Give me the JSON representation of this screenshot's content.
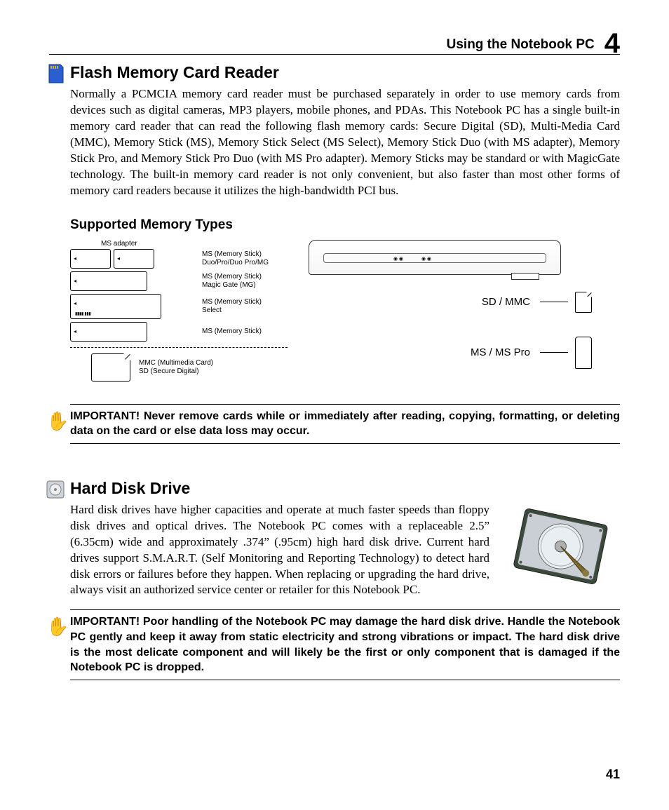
{
  "header": {
    "section_title": "Using the Notebook PC",
    "chapter_number": "4"
  },
  "flash_reader": {
    "heading": "Flash Memory Card Reader",
    "body": "Normally a PCMCIA memory card reader must be purchased separately in order to use memory cards from devices such as digital cameras, MP3 players, mobile phones, and PDAs. This Notebook PC has a single built-in memory card reader that can read the following flash memory cards: Secure Digital (SD), Multi-Media Card (MMC), Memory Stick (MS), Memory Stick Select (MS Select), Memory Stick Duo (with MS adapter), Memory Stick Pro, and Memory Stick Pro Duo (with MS Pro adapter). Memory Sticks may be standard or with MagicGate technology. The built-in memory card reader is not only convenient, but also faster than most other forms of memory card readers because it utilizes the high-bandwidth PCI bus."
  },
  "supported": {
    "heading": "Supported Memory Types",
    "ms_adapter_label": "MS adapter",
    "cards": [
      {
        "label": "MS (Memory Stick)\nDuo/Pro/Duo Pro/MG"
      },
      {
        "label": "MS (Memory Stick)\nMagic Gate (MG)"
      },
      {
        "label": "MS (Memory Stick)\nSelect"
      },
      {
        "label": "MS (Memory Stick)"
      }
    ],
    "bottom_card_label": "MMC (Multimedia Card)\nSD (Secure Digital)",
    "slot_labels": {
      "sd_mmc": "SD / MMC",
      "ms_pro": "MS / MS Pro"
    }
  },
  "warning1": "IMPORTANT!  Never remove cards while or immediately after reading, copying, formatting, or deleting data on the card or else data loss may occur.",
  "hdd": {
    "heading": "Hard Disk Drive",
    "body": "Hard disk drives have higher capacities and operate at much faster speeds than floppy disk drives and optical drives. The Notebook PC comes with a replaceable 2.5” (6.35cm) wide and approximately .374” (.95cm) high hard disk drive. Current hard drives support S.M.A.R.T. (Self Monitoring and Reporting Technology) to detect hard disk errors or failures before they happen. When replacing or upgrading the hard drive, always visit an authorized service center or retailer for this Notebook PC."
  },
  "warning2": "IMPORTANT!  Poor handling of the Notebook PC may damage the hard disk drive. Handle the Notebook PC gently and keep it away from static electricity and strong vibrations or impact. The hard disk drive is the most delicate component and will likely be the first or only component that is damaged if the Notebook PC is dropped.",
  "page_number": "41"
}
